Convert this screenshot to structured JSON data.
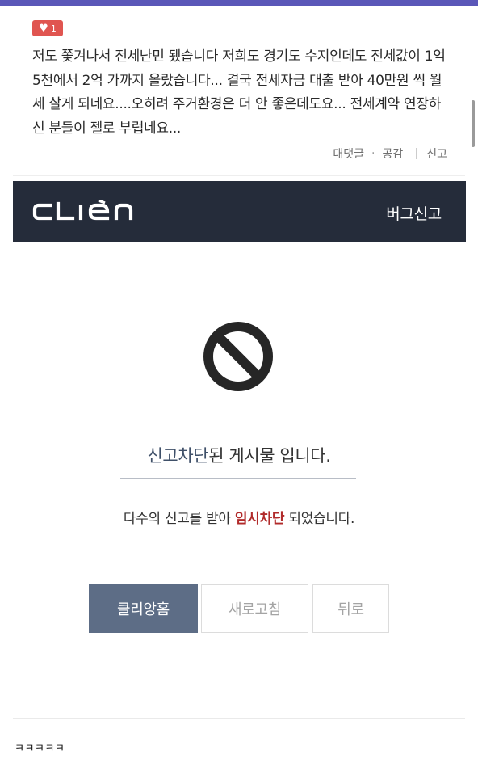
{
  "comment": {
    "like_count": "1",
    "text": "저도 쫓겨나서 전세난민 됐습니다 저희도 경기도 수지인데도 전세값이 1억5천에서 2억 가까지 올랐습니다... 결국 전세자금 대출 받아 40만원 씩 월세 살게 되네요....오히려 주거환경은 더 안 좋은데도요... 전세계약 연장하신 분들이 젤로 부럽네요...",
    "actions": {
      "reply": "대댓글",
      "like": "공감",
      "report": "신고"
    }
  },
  "header": {
    "logo": "CLIén",
    "bug_report": "버그신고"
  },
  "blocked": {
    "title_highlight": "신고차단",
    "title_rest": "된 게시물 입니다.",
    "desc_prefix": "다수의 신고를 받아 ",
    "desc_highlight": "임시차단",
    "desc_suffix": " 되었습니다."
  },
  "buttons": {
    "home": "클리앙홈",
    "refresh": "새로고침",
    "back": "뒤로"
  },
  "caption": "ㅋㅋㅋㅋㅋ",
  "icons": {
    "like": "heart-icon",
    "block": "prohibited-icon"
  },
  "colors": {
    "header_bg": "#252c3a",
    "like_badge": "#e05550",
    "primary_button": "#5d6d86",
    "highlight_red": "#b12a2a",
    "top_bar": "#5a57b8"
  }
}
